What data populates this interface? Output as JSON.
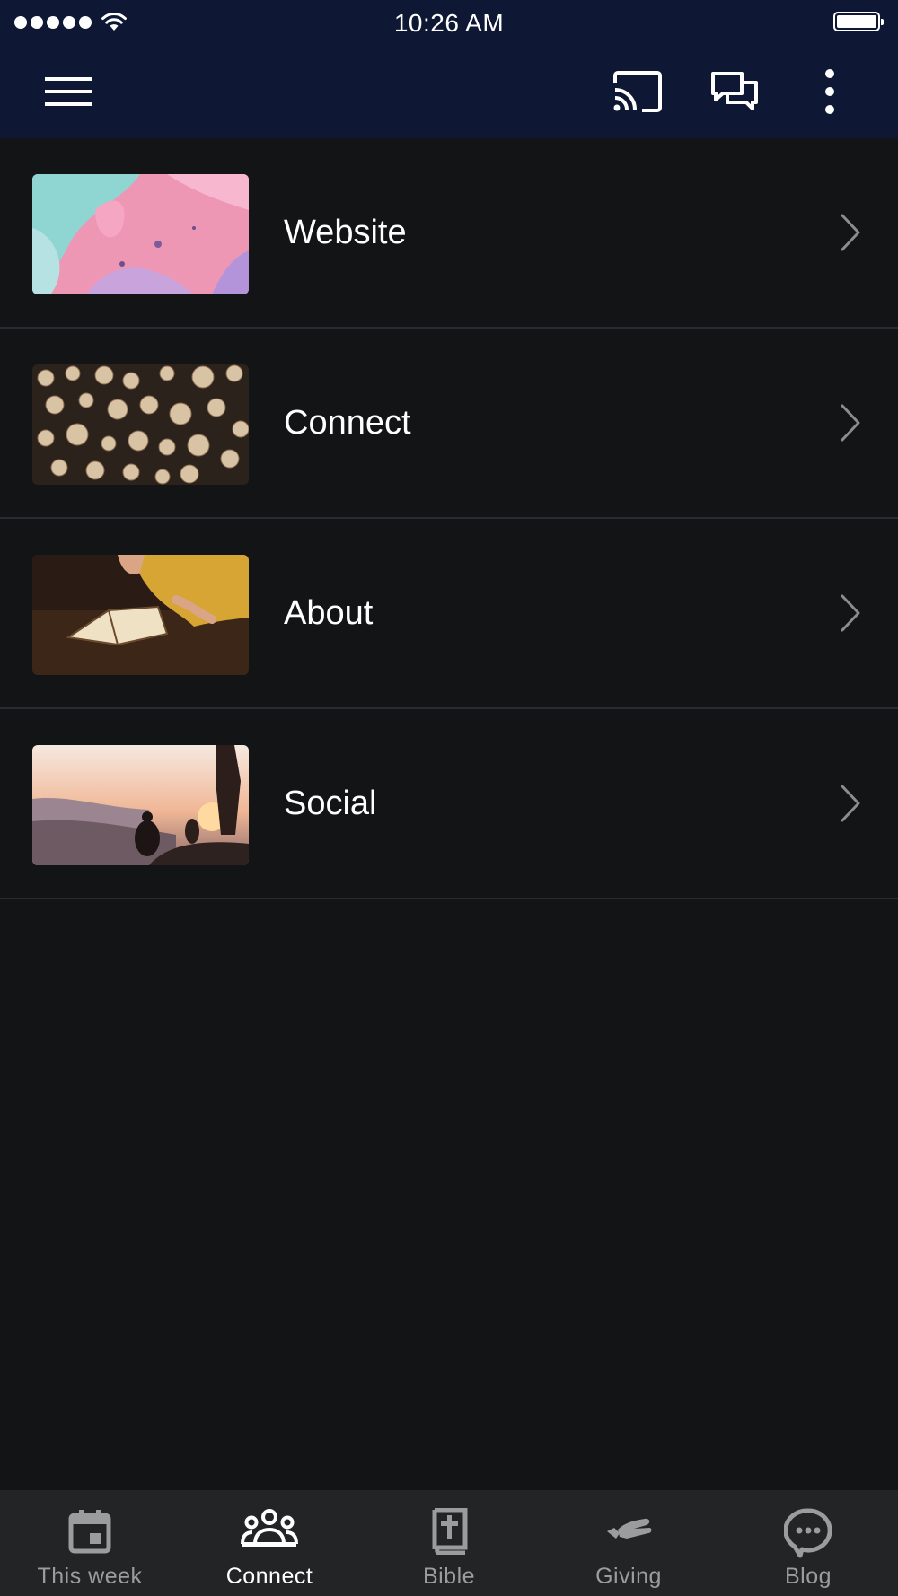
{
  "status_bar": {
    "time": "10:26 AM"
  },
  "header": {
    "menu_icon": "hamburger-menu-icon",
    "actions": [
      "cast-icon",
      "chat-icon",
      "more-vert-icon"
    ],
    "background": "#0e1834"
  },
  "list": {
    "items": [
      {
        "label": "Website",
        "thumbnail": "pink-fluid-art-image"
      },
      {
        "label": "Connect",
        "thumbnail": "cut-logs-image"
      },
      {
        "label": "About",
        "thumbnail": "open-bible-image"
      },
      {
        "label": "Social",
        "thumbnail": "sunset-hikers-image"
      }
    ]
  },
  "tabs": {
    "items": [
      {
        "label": "This week",
        "icon": "calendar-icon",
        "active": false
      },
      {
        "label": "Connect",
        "icon": "people-group-icon",
        "active": true
      },
      {
        "label": "Bible",
        "icon": "bible-icon",
        "active": false
      },
      {
        "label": "Giving",
        "icon": "giving-hand-icon",
        "active": false
      },
      {
        "label": "Blog",
        "icon": "chat-bubble-icon",
        "active": false
      }
    ]
  },
  "colors": {
    "header_bg": "#0e1834",
    "page_bg": "#131415",
    "tab_bar_bg": "#232426",
    "active_tab": "#ffffff",
    "inactive_tab": "#9b9c9e"
  }
}
